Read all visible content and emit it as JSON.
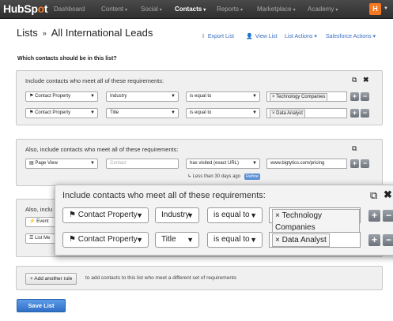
{
  "topnav": {
    "logo_a": "HubSp",
    "logo_o": "o",
    "logo_b": "t",
    "items": [
      "Dashboard",
      "Content",
      "Social",
      "Contacts",
      "Reports",
      "Marketplace",
      "Academy"
    ],
    "account_initial": "H"
  },
  "page": {
    "title_lists": "Lists",
    "separator": "»",
    "title_name": "All International Leads"
  },
  "actions": {
    "export": "Export List",
    "view": "View List",
    "list_actions": "List Actions",
    "salesforce": "Salesforce Actions"
  },
  "question": "Which contacts should be in this list?",
  "group1": {
    "heading": "Include contacts who meet all of these requirements:",
    "rows": [
      {
        "type": "Contact Property",
        "property": "Industry",
        "operator": "is equal to",
        "value": "Technology Companies"
      },
      {
        "type": "Contact Property",
        "property": "Title",
        "operator": "is equal to",
        "value": "Data Analyst"
      }
    ]
  },
  "group2": {
    "heading": "Also, include contacts who meet all of these requirements:",
    "row": {
      "type": "Page View",
      "placeholder": "Contact",
      "operator": "has visited (exact URL)",
      "value": "www.bigtytics.com/pricing"
    },
    "subline": "Less than 30 days ago",
    "refine": "Refine"
  },
  "group3": {
    "heading_partial": "Also, inclu",
    "row1_label": "Event",
    "row2_label": "List Me"
  },
  "add_rule": {
    "button": "+ Add another rule",
    "text": "to add contacts to this list who meet a different set of requirements"
  },
  "save": "Save List",
  "zoom": {
    "heading": "Include contacts who meet all of these requirements:",
    "rows": [
      {
        "type": "Contact Property",
        "property": "Industry",
        "operator": "is equal to",
        "value": "Technology Companies"
      },
      {
        "type": "Contact Property",
        "property": "Title",
        "operator": "is equal to",
        "value": "Data Analyst"
      }
    ]
  },
  "icons": {
    "copy": "copy-icon",
    "close": "close-icon",
    "flag": "flag-icon",
    "plus": "+",
    "minus": "−"
  },
  "colors": {
    "accent": "#f57722",
    "link": "#3a6fbf",
    "save": "#2f6fc6"
  }
}
